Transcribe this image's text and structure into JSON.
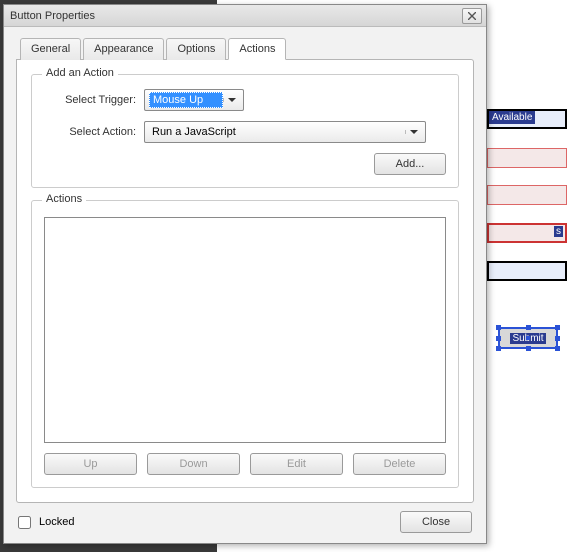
{
  "dialog": {
    "title": "Button Properties",
    "tabs": [
      "General",
      "Appearance",
      "Options",
      "Actions"
    ],
    "active_tab": "Actions",
    "add_action": {
      "group_label": "Add an Action",
      "trigger_label": "Select Trigger:",
      "trigger_value": "Mouse Up",
      "action_label": "Select Action:",
      "action_value": "Run a JavaScript",
      "add_button": "Add..."
    },
    "actions_group": {
      "label": "Actions",
      "buttons": {
        "up": "Up",
        "down": "Down",
        "edit": "Edit",
        "delete": "Delete"
      }
    },
    "locked_label": "Locked",
    "locked_checked": false,
    "close_button": "Close"
  },
  "background": {
    "available_badge": "Available",
    "red_badge": "s",
    "submit_label": "Submit"
  }
}
